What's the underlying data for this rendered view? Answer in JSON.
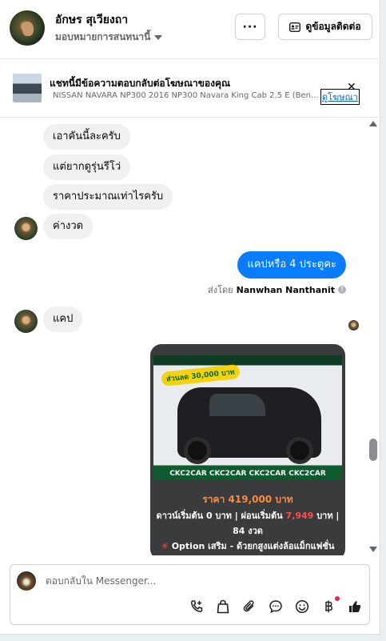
{
  "header": {
    "contact_name": "อักษร สุเวียงถา",
    "assign_label": "มอบหมายการสนทนานี้",
    "more_label": "···",
    "contact_info_label": "ดูข้อมูลติดต่อ"
  },
  "ad_banner": {
    "title": "แชทนี้มีข้อความตอบกลับต่อโฆษณาของคุณ",
    "subtitle": "NISSAN NAVARA NP300 2016 NP300 Navara King Cab 2.5 E (Ben...",
    "link_label": "ดูโฆษณา",
    "close_label": "✕"
  },
  "messages": {
    "incoming_1": "เอาคันนี้ละครับ",
    "incoming_2": "แต่ยากดูรุ่นรีโว่",
    "incoming_3": "ราคาประมาณเท่าไรครับ",
    "incoming_4": "ค่างวด",
    "outgoing_1": "แคปหรือ  4 ประตูคะ",
    "sent_by_prefix": "ส่งโดย",
    "sent_by_name": "Nanwhan Nanthanit",
    "incoming_5": "แคป"
  },
  "product_card": {
    "badge": "ส่วนลด 30,000 บาท",
    "banner": "CKC2CAR CKC2CAR CKC2CAR CKC2CAR",
    "price": "ราคา 419,000 บาท",
    "line1_prefix": "ดาวน์เริ่มต้น 0 บาท | ผ่อนเริ่มต้น",
    "line1_highlight": "7,949",
    "line1_suffix": "บาท |",
    "line2": "84 งวด",
    "line3_mark": "✳",
    "line3": "Option เสริม - ด้วยกสูงแต่งล้อแม็กแฟชั่น"
  },
  "composer": {
    "placeholder": "ตอบกลับใน Messenger..."
  },
  "icons": [
    "phone-plus-icon",
    "bag-icon",
    "paperclip-icon",
    "chat-bubble-icon",
    "smiley-icon",
    "baht-icon",
    "thumbs-up-icon"
  ]
}
